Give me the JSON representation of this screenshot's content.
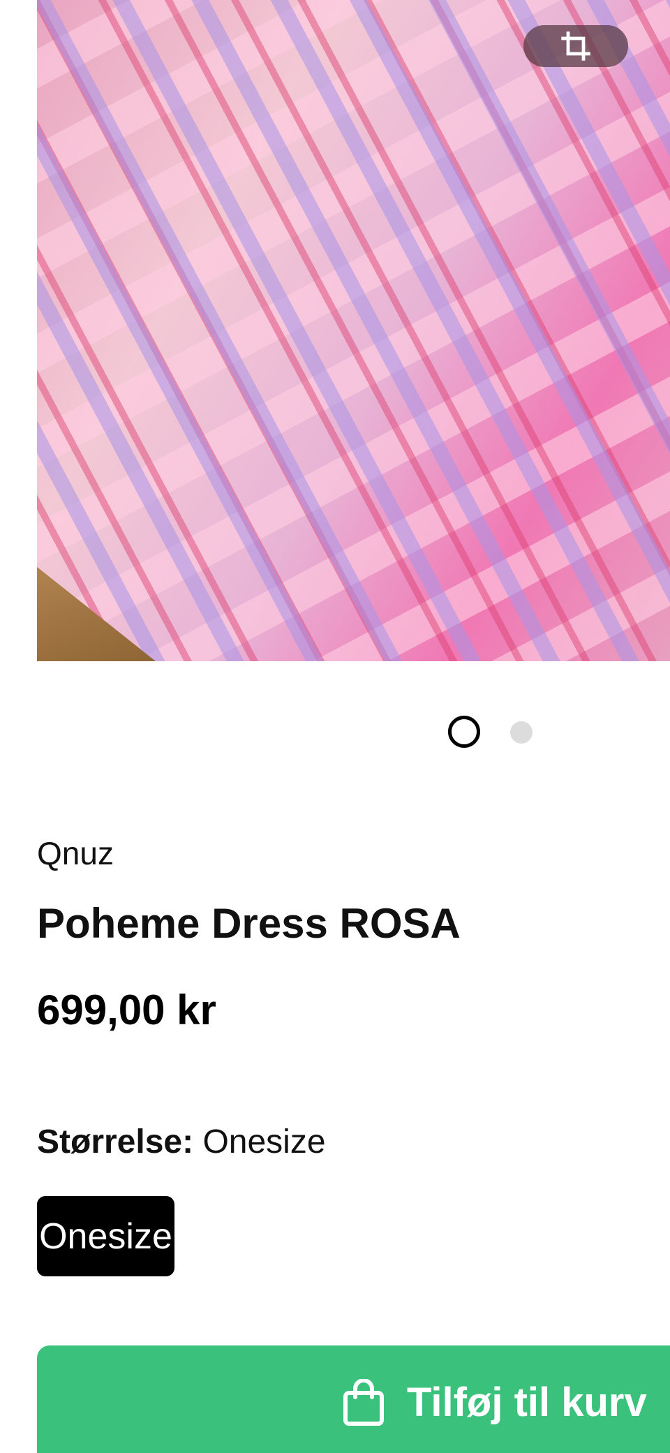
{
  "product": {
    "brand": "Qnuz",
    "title": "Poheme Dress ROSA",
    "price": "699,00 kr"
  },
  "gallery": {
    "image_count": 2,
    "active_index": 0
  },
  "size": {
    "label": "Størrelse:",
    "selected": "Onesize",
    "options": [
      "Onesize"
    ]
  },
  "cart": {
    "button_label": "Tilføj til kurv",
    "button_color": "#3ac27c"
  },
  "icons": [
    "crop-icon",
    "shopping-bag-icon"
  ]
}
